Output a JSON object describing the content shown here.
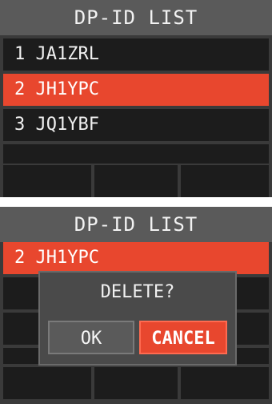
{
  "screen1": {
    "title": "DP-ID LIST",
    "items": [
      {
        "label": "1 JA1ZRL",
        "selected": false
      },
      {
        "label": "2 JH1YPC",
        "selected": true
      },
      {
        "label": "3 JQ1YBF",
        "selected": false
      }
    ]
  },
  "screen2": {
    "title": "DP-ID LIST",
    "selected_item": "2 JH1YPC",
    "dialog": {
      "message": "DELETE?",
      "ok_label": "OK",
      "cancel_label": "CANCEL"
    }
  },
  "colors": {
    "accent": "#e8472e",
    "row_bg": "#1c1c1c",
    "title_bg": "#5a5a5a"
  }
}
